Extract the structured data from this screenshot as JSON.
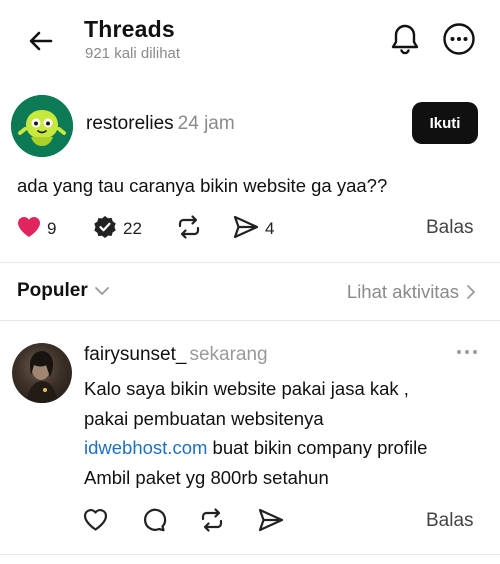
{
  "header": {
    "title": "Threads",
    "views": "921 kali dilihat",
    "icons": [
      "back-arrow-icon",
      "bell-icon",
      "more-icon"
    ]
  },
  "post": {
    "username": "restorelies",
    "time": "24 jam",
    "follow_label": "Ikuti",
    "text": "ada yang tau caranya bikin website ga yaa??",
    "likes": "9",
    "replies": "22",
    "shares": "4",
    "reply_label": "Balas",
    "colors": {
      "like": "#e0245e",
      "follow_bg": "#101010"
    }
  },
  "sort": {
    "label": "Populer",
    "activity_label": "Lihat aktivitas"
  },
  "comment": {
    "username": "fairysunset_",
    "time": "sekarang",
    "line1": "Kalo saya bikin website pakai jasa kak ,",
    "line2": "pakai pembuatan websitenya",
    "link": "idwebhost.com",
    "line3_rest": " buat bikin company profile",
    "line4": "Ambil paket yg 800rb setahun",
    "reply_label": "Balas",
    "colors": {
      "link": "#1e6fc2"
    }
  }
}
